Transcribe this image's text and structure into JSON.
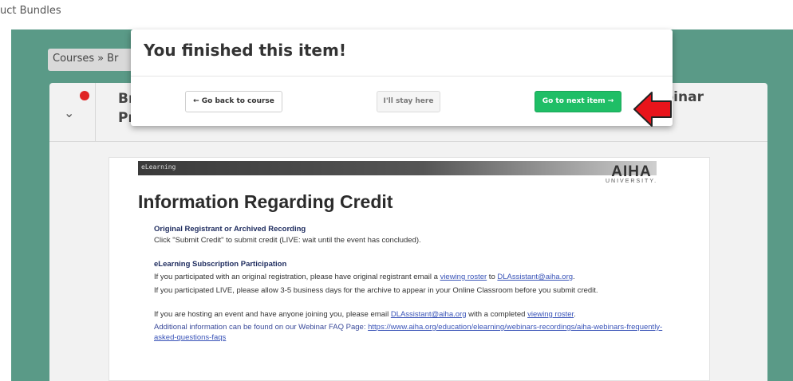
{
  "top_breadcrumb": "uct Bundles",
  "breadcrumb": {
    "courses": "Courses",
    "separator": "»",
    "fragment": "Br"
  },
  "card": {
    "title_fragment_1": "Br",
    "title_fragment_2": "Pr",
    "title_right": "binar"
  },
  "modal": {
    "title": "You finished this item!",
    "back_label": "← Go back to course",
    "stay_label": "I'll stay here",
    "next_label": "Go to next item →"
  },
  "slide": {
    "banner_label": "eLearning",
    "logo_main": "AIHA",
    "logo_sub": "UNIVERSITY.",
    "heading": "Information Regarding Credit",
    "sec1_title": "Original Registrant or Archived Recording",
    "sec1_text": "Click \"Submit Credit\" to submit credit (LIVE: wait until the event has concluded).",
    "sec2_title": "eLearning Subscription Participation",
    "p1_a": "If you participated with an original registration, please have original registrant email a ",
    "p1_link1": "viewing roster",
    "p1_b": " to ",
    "p1_link2": "DLAssistant@aiha.org",
    "p1_c": ".",
    "p2": "If you participated LIVE, please allow 3-5 business days for the archive to appear in your Online Classroom before you submit credit.",
    "p3_a": "If you are hosting an event and have anyone joining you, please email ",
    "p3_link1": "DLAssistant@aiha.org",
    "p3_b": " with a completed ",
    "p3_link2": "viewing roster",
    "p3_c": ".",
    "p4_a": "Additional information can be found on our Webinar FAQ Page: ",
    "p4_link": "https://www.aiha.org/education/elearning/webinars-recordings/aiha-webinars-frequently-asked-questions-faqs"
  },
  "colors": {
    "teal": "#5a9a87",
    "green_button": "#1fbe66",
    "arrow_red": "#e8141b"
  }
}
